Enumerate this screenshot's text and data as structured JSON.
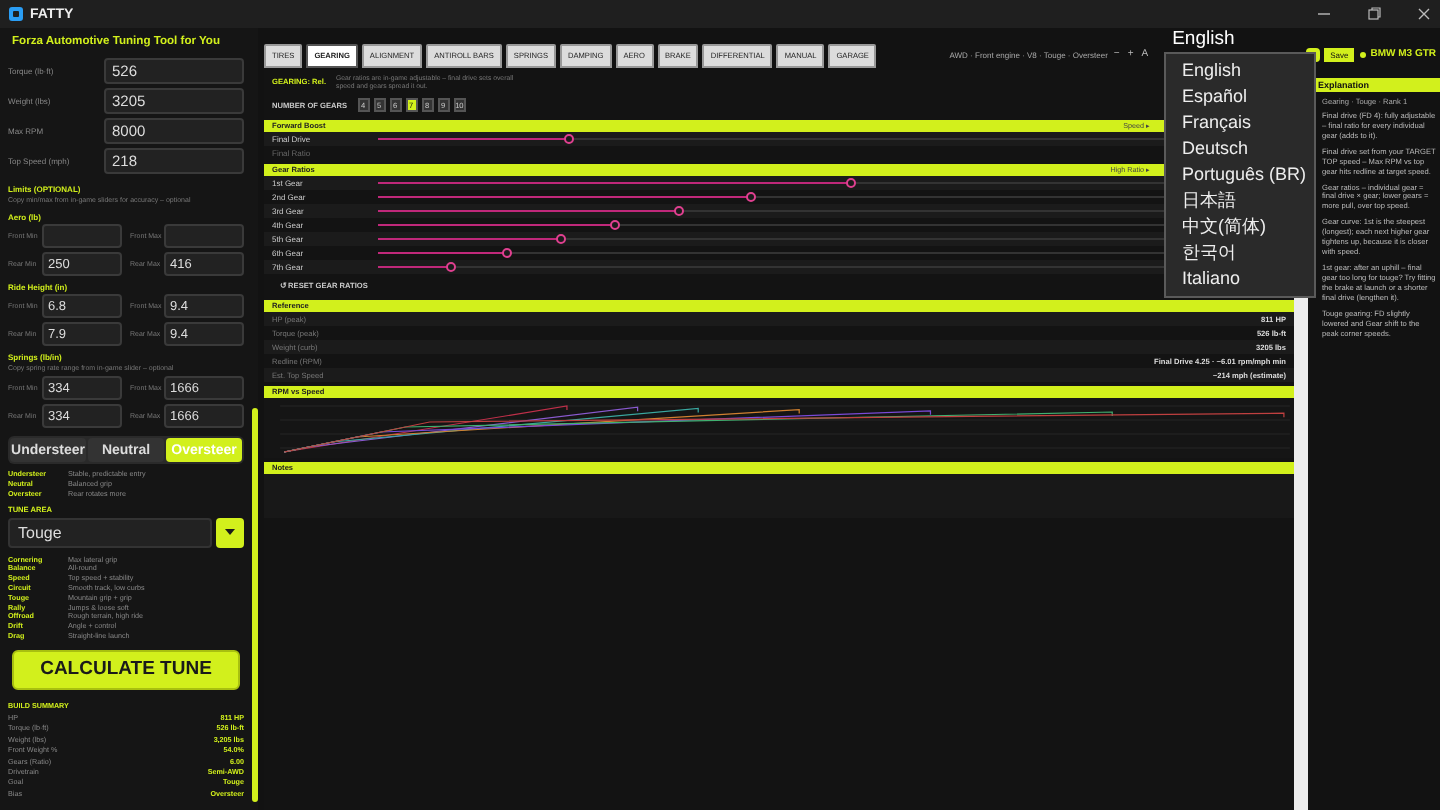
{
  "window": {
    "title": "FATTY"
  },
  "app_heading": "Forza Automotive Tuning Tool for You",
  "inputs": [
    {
      "label": "Torque (lb·ft)",
      "value": "526"
    },
    {
      "label": "Weight (lbs)",
      "value": "3205"
    },
    {
      "label": "Max RPM",
      "value": "8000"
    },
    {
      "label": "Top Speed (mph)",
      "value": "218"
    }
  ],
  "limits": {
    "title": "Limits (OPTIONAL)",
    "note": "Copy min/max from in-game sliders for accuracy – optional",
    "groups": [
      {
        "title": "Aero (lb)",
        "fields": [
          {
            "label": "Front Min"
          },
          {
            "label": "Front Max"
          },
          {
            "label": "Rear Min",
            "value": "250"
          },
          {
            "label": "Rear Max",
            "value": "416"
          }
        ]
      },
      {
        "title": "Ride Height (in)",
        "fields": [
          {
            "label": "Front Min",
            "value": "6.8"
          },
          {
            "label": "Front Max",
            "value": "9.4"
          },
          {
            "label": "Rear Min",
            "value": "7.9"
          },
          {
            "label": "Rear Max",
            "value": "9.4"
          }
        ]
      },
      {
        "title": "Springs (lb/in)",
        "note": "Copy spring rate range from in-game slider – optional",
        "fields": [
          {
            "label": "Front Min",
            "value": "334"
          },
          {
            "label": "Front Max",
            "value": "1666"
          },
          {
            "label": "Rear Min",
            "value": "334"
          },
          {
            "label": "Rear Max",
            "value": "1666"
          }
        ]
      }
    ]
  },
  "balance": {
    "options": [
      {
        "label": "Understeer",
        "selected": false
      },
      {
        "label": "Neutral",
        "selected": false
      },
      {
        "label": "Oversteer",
        "selected": true
      }
    ],
    "descriptions": [
      {
        "term": "Understeer",
        "text": "Stable, predictable entry"
      },
      {
        "term": "Neutral",
        "text": "Balanced grip"
      },
      {
        "term": "Oversteer",
        "text": "Rear rotates more"
      }
    ]
  },
  "tune_area": {
    "label": "TUNE AREA",
    "value": "Touge",
    "modes": [
      {
        "term": "Cornering",
        "text": "Max lateral grip"
      },
      {
        "term": "Balance",
        "text": "All-round"
      },
      {
        "term": "Speed",
        "text": "Top speed + stability"
      },
      {
        "term": "Circuit",
        "text": "Smooth track, low curbs"
      },
      {
        "term": "Touge",
        "text": "Mountain grip + grip"
      },
      {
        "term": "Rally",
        "text": "Jumps & loose soft"
      },
      {
        "term": "Offroad",
        "text": "Rough terrain, high ride"
      },
      {
        "term": "Drift",
        "text": "Angle + control"
      },
      {
        "term": "Drag",
        "text": "Straight-line launch"
      }
    ]
  },
  "calculate_button": "CALCULATE TUNE",
  "build_summary": {
    "title": "BUILD SUMMARY",
    "rows": [
      {
        "label": "HP",
        "value": "811 HP"
      },
      {
        "label": "Torque (lb·ft)",
        "value": "526 lb-ft"
      },
      {
        "label": "Weight (lbs)",
        "value": "3,205 lbs"
      },
      {
        "label": "Front Weight %",
        "value": "54.0%"
      },
      {
        "label": "Gears (Ratio)",
        "value": "6.00"
      },
      {
        "label": "Drivetrain",
        "value": "Semi-AWD"
      },
      {
        "label": "Goal",
        "value": "Touge"
      },
      {
        "label": "Bias",
        "value": "Oversteer"
      }
    ]
  },
  "tabs": [
    {
      "label": "TIRES",
      "selected": false
    },
    {
      "label": "GEARING",
      "selected": true
    },
    {
      "label": "ALIGNMENT",
      "selected": false
    },
    {
      "label": "ANTIROLL BARS",
      "selected": false
    },
    {
      "label": "SPRINGS",
      "selected": false
    },
    {
      "label": "DAMPING",
      "selected": false
    },
    {
      "label": "AERO",
      "selected": false
    },
    {
      "label": "BRAKE",
      "selected": false
    },
    {
      "label": "DIFFERENTIAL",
      "selected": false
    },
    {
      "label": "MANUAL",
      "selected": false
    },
    {
      "label": "GARAGE",
      "selected": false
    }
  ],
  "toolbar": {
    "info": "AWD · Front engine · V8 · Touge · Oversteer",
    "font_buttons": [
      "−",
      "+",
      "A"
    ],
    "language": "English",
    "toggle_on": true,
    "save": "Save",
    "car": "BMW M3 GTR"
  },
  "gearing": {
    "label": "GEARING: Rel.",
    "note": "Gear ratios are in-game adjustable – final drive sets overall speed and gears spread it out.",
    "count_label": "NUMBER OF GEARS",
    "counts": [
      {
        "label": "4",
        "selected": false
      },
      {
        "label": "5",
        "selected": false
      },
      {
        "label": "6",
        "selected": false
      },
      {
        "label": "7",
        "selected": true
      },
      {
        "label": "8",
        "selected": false
      },
      {
        "label": "9",
        "selected": false
      },
      {
        "label": "10",
        "selected": false
      }
    ]
  },
  "final_drive": {
    "title": "Forward Boost",
    "hint": "Speed ▸",
    "rows": [
      {
        "kind": "slider",
        "label": "Final Drive",
        "level": 0.21
      },
      {
        "kind": "text",
        "label": "Final Ratio"
      }
    ]
  },
  "gear_ratios": {
    "title": "Gear Ratios",
    "hint": "High Ratio ▸",
    "reset": "↺ RESET GEAR RATIOS",
    "gears": [
      {
        "label": "1st Gear",
        "level": 0.52
      },
      {
        "label": "2nd Gear",
        "level": 0.41
      },
      {
        "label": "3rd Gear",
        "level": 0.33
      },
      {
        "label": "4th Gear",
        "level": 0.26
      },
      {
        "label": "5th Gear",
        "level": 0.2
      },
      {
        "label": "6th Gear",
        "level": 0.14
      },
      {
        "label": "7th Gear",
        "level": 0.08
      }
    ]
  },
  "reference": {
    "title": "Reference",
    "rows": [
      {
        "label": "HP (peak)",
        "value": "811 HP"
      },
      {
        "label": "Torque (peak)",
        "value": "526 lb-ft"
      },
      {
        "label": "Weight (curb)",
        "value": "3205 lbs"
      },
      {
        "label": "Redline (RPM)",
        "value": "Final Drive 4.25 · ~6.01 rpm/mph min"
      },
      {
        "label": "Est. Top Speed",
        "value": "~214 mph (estimate)"
      }
    ]
  },
  "rpm_chart": {
    "title": "RPM vs Speed"
  },
  "notes": {
    "title": "Notes"
  },
  "language_menu": {
    "options": [
      "English",
      "Español",
      "Français",
      "Deutsch",
      "Português (BR)",
      "日本語",
      "中文(简体)",
      "한국어",
      "Italiano"
    ]
  },
  "explanation": {
    "title": "Explanation",
    "subtitle": "Gearing · Touge · Rank 1",
    "paragraphs": [
      "Final drive (FD 4): fully adjustable – final ratio for every individual gear (adds to it).",
      "Final drive set from your TARGET TOP speed – Max RPM vs top gear hits redline at target speed.",
      "Gear ratios – individual gear = final drive × gear; lower gears = more pull, over top speed.",
      "Gear curve: 1st is the steepest (longest); each next higher gear tightens up, because it is closer with speed.",
      "1st gear: after an uphill – final gear too long for touge? Try fitting the brake at launch or a shorter final drive (lengthen it).",
      "Touge gearing: FD slightly lowered and Gear shift to the peak corner speeds."
    ]
  }
}
